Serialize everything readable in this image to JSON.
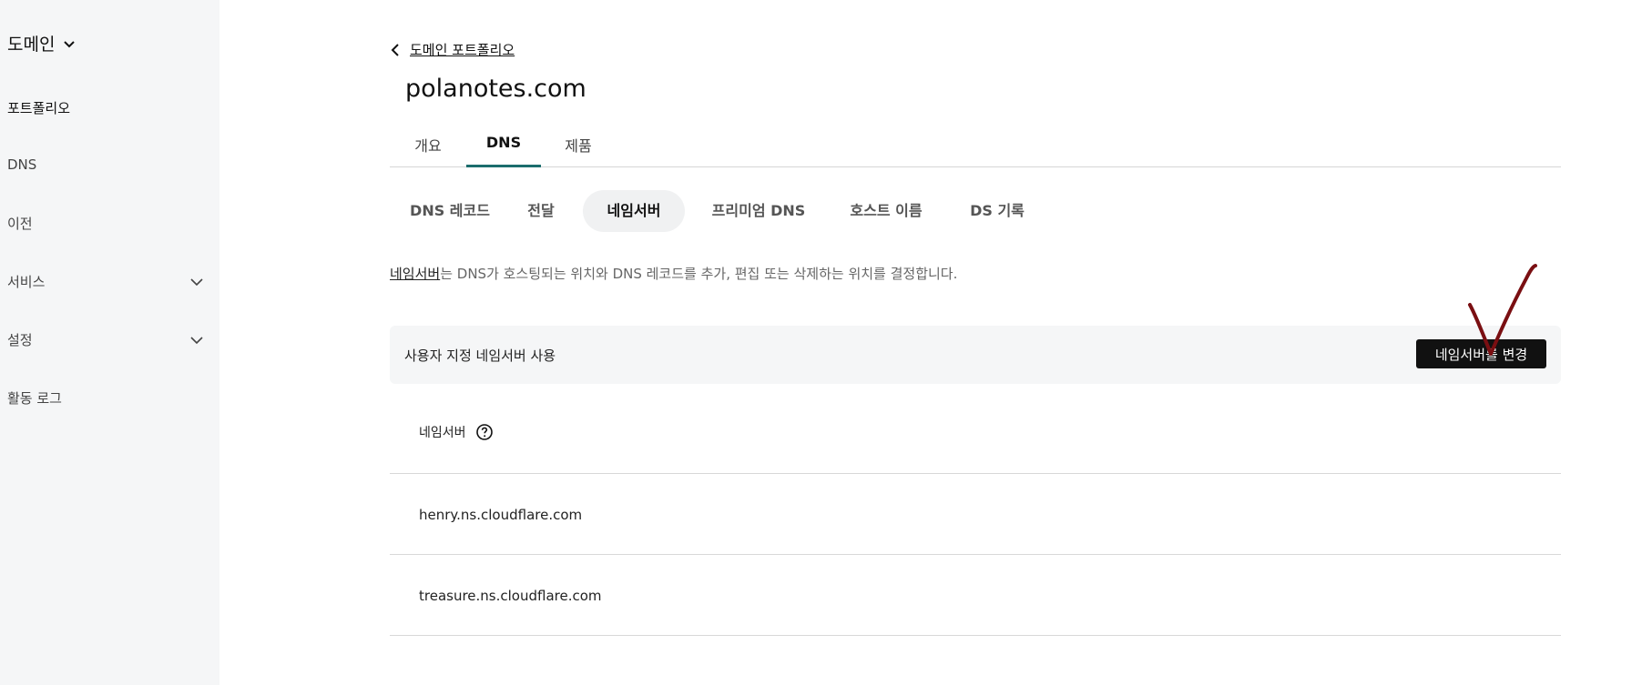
{
  "sidebar": {
    "heading": "도메인",
    "items": [
      {
        "label": "포트폴리오",
        "expandable": false,
        "active": true
      },
      {
        "label": "DNS",
        "expandable": false,
        "active": false
      },
      {
        "label": "이전",
        "expandable": false,
        "active": false
      },
      {
        "label": "서비스",
        "expandable": true,
        "active": false
      },
      {
        "label": "설정",
        "expandable": true,
        "active": false
      },
      {
        "label": "활동 로그",
        "expandable": false,
        "active": false
      }
    ]
  },
  "breadcrumb": {
    "label": "도메인 포트폴리오"
  },
  "page_title": "polanotes.com",
  "tabs": [
    {
      "label": "개요",
      "active": false
    },
    {
      "label": "DNS",
      "active": true
    },
    {
      "label": "제품",
      "active": false
    }
  ],
  "subtabs": [
    {
      "label": "DNS 레코드",
      "active": false
    },
    {
      "label": "전달",
      "active": false
    },
    {
      "label": "네임서버",
      "active": true
    },
    {
      "label": "프리미엄 DNS",
      "active": false
    },
    {
      "label": "호스트 이름",
      "active": false
    },
    {
      "label": "DS 기록",
      "active": false
    }
  ],
  "description": {
    "link_text": "네임서버",
    "rest": "는 DNS가 호스팅되는 위치와 DNS 레코드를 추가, 편집 또는 삭제하는 위치를 결정합니다."
  },
  "panel": {
    "label": "사용자 지정 네임서버 사용",
    "button_label": "네임서버를 변경"
  },
  "nameservers": {
    "header": "네임서버",
    "values": [
      "henry.ns.cloudflare.com",
      "treasure.ns.cloudflare.com"
    ]
  },
  "colors": {
    "active_tab_underline": "#1b6d6d",
    "primary_button": "#111111",
    "sidebar_bg": "#f5f6f7",
    "annotation_mark": "#7a0f12"
  }
}
